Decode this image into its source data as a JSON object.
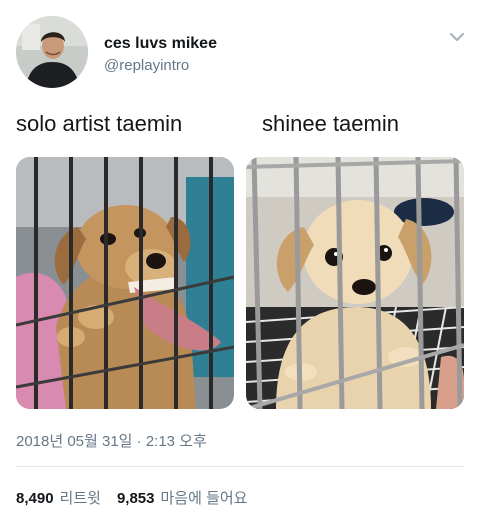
{
  "user": {
    "display_name": "ces luvs mikee",
    "handle": "@replayintro",
    "avatar_icon": "profile-avatar"
  },
  "menu": {
    "icon": "chevron-down-icon"
  },
  "captions": {
    "left": "solo artist taemin",
    "right": "shinee taemin"
  },
  "images": {
    "left": "puppy-in-cage-growling",
    "right": "puppy-in-cage-cute"
  },
  "timestamp": "2018년 05월 31일 · 2:13 오후",
  "stats": {
    "retweets_count": "8,490",
    "retweets_label": "리트윗",
    "likes_count": "9,853",
    "likes_label": "마음에 들어요"
  },
  "colors": {
    "text": "#14171a",
    "secondary": "#657786",
    "divider": "#e1e8ed"
  }
}
